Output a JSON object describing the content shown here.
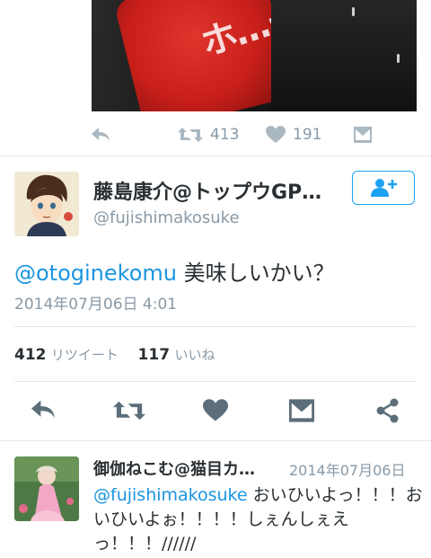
{
  "photo": {
    "visible_text": "ホ…ートーセ"
  },
  "prev_tweet_actions": {
    "retweet_count": "413",
    "like_count": "191"
  },
  "main_tweet": {
    "display_name": "藤島康介@トップウGP…",
    "handle": "@fujishimakosuke",
    "mention": "@otoginekomu",
    "text": " 美味しいかい？",
    "timestamp": "2014年07月06日 4:01",
    "retweets_count": "412",
    "retweets_label": "リツイート",
    "likes_count": "117",
    "likes_label": "いいね"
  },
  "reply": {
    "display_name": "御伽ねこむ@猫目カ…",
    "date": "2014年07月06日",
    "mention": "@fujishimakosuke",
    "text": " おいひいよっ！！！おいひいよぉ！！！！しぇんしぇえっ！！！//////"
  },
  "colors": {
    "accent": "#1da1f2",
    "mention": "#1b95e0",
    "muted": "#8899a6",
    "icon": "#aab8c2",
    "dark_icon": "#5c6e7a"
  }
}
